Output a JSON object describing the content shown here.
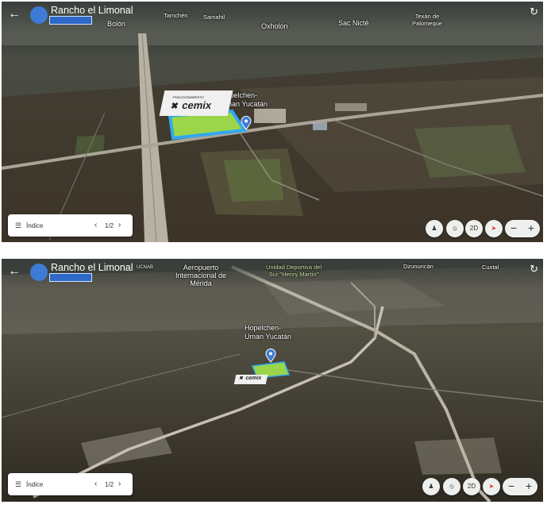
{
  "panels": [
    {
      "title": "Rancho el Limonal",
      "places": {
        "tamchen": "Tamchén",
        "samahil": "Samahil",
        "bolon": "Bolón",
        "oxholon": "Oxholón",
        "sacnicte": "Sac Nicté",
        "texan": "Texán de Palomeque",
        "site": "Hopelchen-Uman Yucatán"
      },
      "logo": {
        "caption": "FRACCIONAMIENTO",
        "brand": "cemix"
      },
      "index": {
        "label": "Índice",
        "page": "1/2"
      },
      "controls": {
        "view2d": "2D"
      }
    },
    {
      "title": "Rancho el Limonal",
      "places": {
        "ucnab": "UCNAB",
        "airport": "Aeropuerto Internacional de Mérida",
        "unidad": "Unidad Deportiva del Sur \"Henry Martín\"",
        "dzununcan": "Dzununcán",
        "cuxtal": "Cuxtal",
        "site": "Hopelchen-Uman Yucatán"
      },
      "logo": {
        "brand": "cemix"
      },
      "index": {
        "label": "Índice",
        "page": "1/2"
      },
      "controls": {
        "view2d": "2D"
      }
    }
  ],
  "colors": {
    "accent": "#3d7bd6",
    "parcel": "#9bd64a",
    "parcel_outline": "#2fa9f0"
  },
  "icons": [
    "back-arrow-icon",
    "refresh-icon",
    "list-icon",
    "chevron-left-icon",
    "chevron-right-icon",
    "pegman-icon",
    "tilt-icon",
    "compass-icon",
    "minus-icon",
    "plus-icon",
    "location-pin-icon"
  ]
}
